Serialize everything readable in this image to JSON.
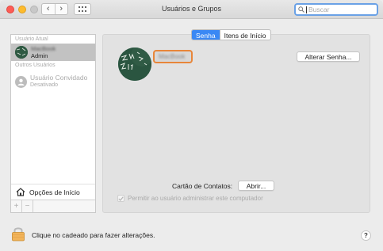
{
  "window": {
    "title": "Usuários e Grupos"
  },
  "toolbar": {
    "back_glyph": "‹",
    "forward_glyph": "›",
    "search_placeholder": "Buscar"
  },
  "sidebar": {
    "current_user_section": "Usuário Atual",
    "current_user": {
      "name": "MacBook",
      "role": "Admin"
    },
    "other_users_section": "Outros Usuários",
    "guest": {
      "name": "Usuário Convidado",
      "status": "Desativado"
    },
    "login_options_label": "Opções de Início",
    "add_label": "+",
    "remove_label": "−"
  },
  "tabs": {
    "password": "Senha",
    "login_items": "Itens de Início",
    "active": "password"
  },
  "user_detail": {
    "name_field_value": "MacBook",
    "change_password_label": "Alterar Senha...",
    "contact_card_label": "Cartão de Contatos:",
    "open_button_label": "Abrir...",
    "allow_admin_label": "Permitir ao usuário administrar este computador"
  },
  "footer": {
    "lock_text": "Clique no cadeado para fazer alterações.",
    "help_label": "?"
  },
  "colors": {
    "accent": "#3a88f4",
    "focus_ring": "#e8863a",
    "selection": "#c2c2c2"
  },
  "icons": {
    "back": "chevron-left-icon",
    "forward": "chevron-right-icon",
    "grid": "grid-icon",
    "search": "search-icon",
    "house": "house-icon",
    "lock": "lock-icon",
    "guest": "person-icon",
    "check": "checkmark-icon"
  }
}
